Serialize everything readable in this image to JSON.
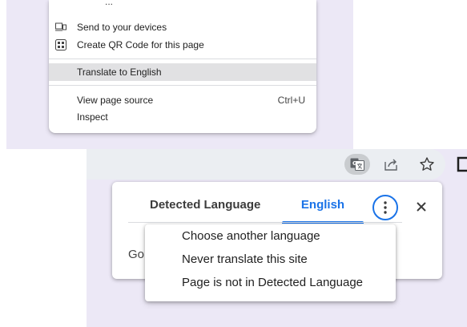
{
  "context_menu": {
    "fragment_above": "...",
    "items": [
      {
        "label": "Send to your devices",
        "icon": "devices-icon"
      },
      {
        "label": "Create QR Code for this page",
        "icon": "qr-code-icon"
      },
      {
        "label": "Translate to English",
        "highlighted": true
      },
      {
        "label": "View page source",
        "shortcut": "Ctrl+U"
      },
      {
        "label": "Inspect"
      }
    ]
  },
  "toolbar": {
    "icons": [
      "translate-icon",
      "share-icon",
      "bookmark-star-icon"
    ]
  },
  "translate_bubble": {
    "source_tab": "Detected Language",
    "target_tab": "English",
    "partial_text": "Go",
    "menu": [
      "Choose another language",
      "Never translate this site",
      "Page is not in Detected Language"
    ]
  },
  "colors": {
    "accent": "#1a73e8",
    "background": "#ece8f6",
    "highlight": "#e1e1e3"
  }
}
